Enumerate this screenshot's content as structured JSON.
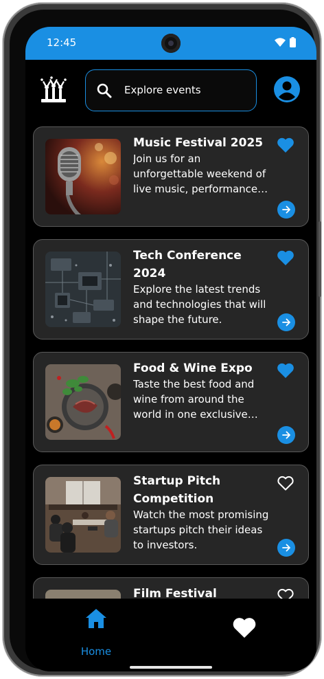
{
  "status_bar": {
    "time": "12:45"
  },
  "header": {
    "search_placeholder": "Explore events"
  },
  "events": [
    {
      "title": "Music Festival 2025",
      "description": "Join us for an unforgettable weekend of live music, performances and more.",
      "favorited": true
    },
    {
      "title": "Tech Conference 2024",
      "description": "Explore the latest trends and technologies that will shape the future.",
      "favorited": true
    },
    {
      "title": "Food & Wine Expo",
      "description": "Taste the best food and wine from around the world in one exclusive event.",
      "favorited": true
    },
    {
      "title": "Startup Pitch Competition",
      "description": "Watch the most promising startups pitch their ideas to investors.",
      "favorited": false
    },
    {
      "title": "Film Festival",
      "description": "",
      "favorited": false
    }
  ],
  "bottom_nav": {
    "home_label": "Home"
  },
  "colors": {
    "accent": "#1a8fe3",
    "card_bg": "#262626",
    "background": "#000000"
  }
}
